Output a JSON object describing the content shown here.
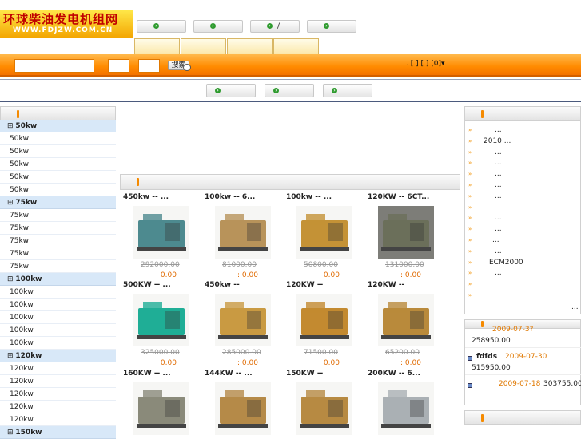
{
  "logo": {
    "title": "环球柴油发电机组网",
    "url": "WWW.FDJZW.COM.CN"
  },
  "top_buttons": [
    "",
    "",
    "/",
    ""
  ],
  "search": {
    "button_label": "搜索"
  },
  "user_links": ". [ ]  [ ]   [0]▾",
  "categories": [
    {
      "name": "50kw",
      "items": [
        "50kw",
        "50kw",
        "50kw",
        "50kw",
        "50kw"
      ]
    },
    {
      "name": "75kw",
      "items": [
        "75kw",
        "75kw",
        "75kw",
        "75kw",
        "75kw"
      ]
    },
    {
      "name": "100kw",
      "items": [
        "100kw",
        "100kw",
        "100kw",
        "100kw",
        "100kw"
      ]
    },
    {
      "name": "120kw",
      "items": [
        "120kw",
        "120kw",
        "120kw",
        "120kw",
        "120kw"
      ]
    },
    {
      "name": "150kw",
      "items": []
    }
  ],
  "products": [
    {
      "title": "450kw         --          ...",
      "old": "292000.00",
      "new": ": 0.00"
    },
    {
      "title": "100kw         --        6...",
      "old": "81000.00",
      "new": ": 0.00"
    },
    {
      "title": "100kw         --          ...",
      "old": "50800.00",
      "new": ": 0.00"
    },
    {
      "title": "120KW         --     6CT...",
      "old": "131000.00",
      "new": ": 0.00"
    },
    {
      "title": "500KW         --      ...",
      "old": "325000.00",
      "new": ": 0.00"
    },
    {
      "title": "450kw         --",
      "old": "285000.00",
      "new": ": 0.00"
    },
    {
      "title": "120KW         --",
      "old": "71500.00",
      "new": ": 0.00"
    },
    {
      "title": "120KW         --",
      "old": "65200.00",
      "new": ": 0.00"
    },
    {
      "title": "160KW        --       ...",
      "old": "",
      "new": ""
    },
    {
      "title": "144KW        --       ...",
      "old": "",
      "new": ""
    },
    {
      "title": "150KW         --",
      "old": "",
      "new": ""
    },
    {
      "title": "200KW         --           6...",
      "old": "",
      "new": ""
    }
  ],
  "right_list": [
    "...",
    "2010     ...",
    "...",
    "...",
    "...",
    "...",
    "...",
    "",
    "...",
    "...",
    "...",
    "...",
    "ECM2000",
    "...",
    "",
    ""
  ],
  "right_more": "...",
  "right2": {
    "rows": [
      {
        "name": "",
        "date": "2009-07-3?",
        "price": "258950.00"
      },
      {
        "name": "fdfds",
        "date": "2009-07-30",
        "price": "515950.00"
      },
      {
        "name": "",
        "date": "2009-07-18",
        "price": "303755.00"
      }
    ]
  },
  "colors": {
    "orange": "#ff8b00",
    "category_bg": "#d8e8f8",
    "price_orange": "#e06a00",
    "date_orange": "#e07800"
  }
}
